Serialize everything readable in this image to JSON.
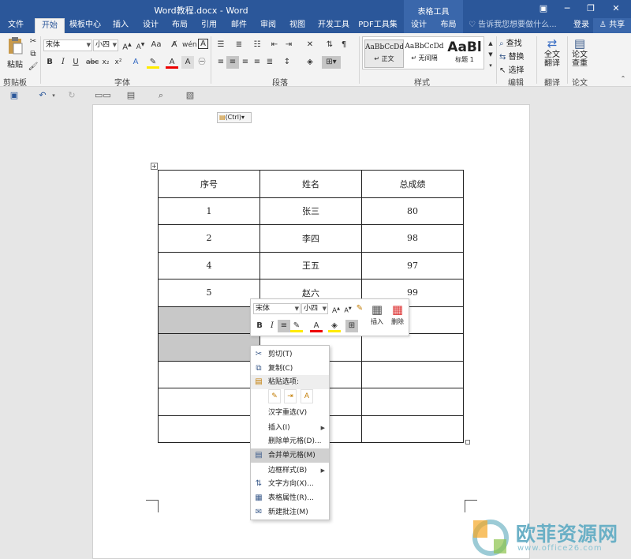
{
  "window": {
    "title": "Word教程.docx - Word",
    "context_group": "表格工具",
    "buttons": [
      "▣",
      "─",
      "❐",
      "✕"
    ]
  },
  "tabs": [
    "文件",
    "开始",
    "模板中心",
    "插入",
    "设计",
    "布局",
    "引用",
    "邮件",
    "审阅",
    "视图",
    "开发工具",
    "PDF工具集",
    "设计",
    "布局"
  ],
  "active_tab": "开始",
  "tell_me": "告诉我您想要做什么...",
  "login": "登录",
  "share": "共享",
  "ribbon": {
    "groups": {
      "clipboard": "剪贴板",
      "font": "字体",
      "paragraph": "段落",
      "styles": "样式",
      "editing": "编辑",
      "translate": "翻译",
      "paper": "论文"
    },
    "paste_label": "粘贴",
    "font_name": "宋体",
    "font_size": "小四",
    "styles": [
      {
        "sample": "AaBbCcDd",
        "name": "↵ 正文"
      },
      {
        "sample": "AaBbCcDd",
        "name": "↵ 无间隔"
      },
      {
        "sample": "AaBl",
        "name": "标题 1"
      }
    ],
    "find": "查找",
    "replace": "替换",
    "select": "选择",
    "full_translate": "全文\n翻译",
    "paper_check": "论文\n查重"
  },
  "doc": {
    "ctrl_label": "(Ctrl)",
    "table": {
      "headers": [
        "序号",
        "姓名",
        "总成绩"
      ],
      "rows": [
        [
          "1",
          "张三",
          "80"
        ],
        [
          "2",
          "李四",
          "98"
        ],
        [
          "4",
          "王五",
          "97"
        ],
        [
          "5",
          "赵六",
          "99"
        ],
        [
          "",
          "",
          ""
        ],
        [
          "",
          "",
          ""
        ],
        [
          "",
          "",
          ""
        ],
        [
          "",
          "",
          ""
        ],
        [
          "",
          "",
          ""
        ]
      ]
    }
  },
  "mini_toolbar": {
    "font_name": "宋体",
    "font_size": "小四",
    "insert": "插入",
    "delete": "删除"
  },
  "context_menu": {
    "cut": "剪切(T)",
    "copy": "复制(C)",
    "paste_options": "粘贴选项:",
    "hanzi_reselect": "汉字重选(V)",
    "insert": "插入(I)",
    "delete_cells": "删除单元格(D)...",
    "merge_cells": "合并单元格(M)",
    "border_style": "边框样式(B)",
    "text_direction": "文字方向(X)...",
    "table_props": "表格属性(R)...",
    "new_comment": "新建批注(M)"
  },
  "watermark": {
    "name": "欧菲资源网",
    "url": "www.office26.com"
  },
  "colors": {
    "title_bar": "#2b579a",
    "ribbon_bg": "#f3f3f3",
    "selection": "#c8c8c8"
  }
}
